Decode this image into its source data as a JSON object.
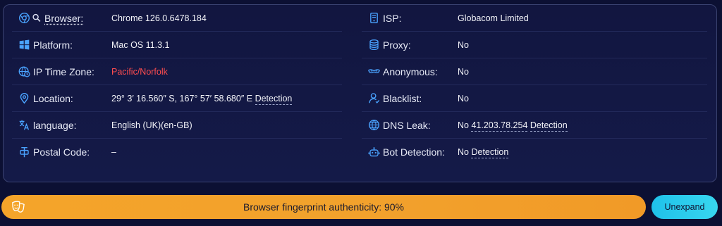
{
  "colors": {
    "accent": "#ff4d4f",
    "progress": "#f4a42a",
    "button": "#2ccbe9",
    "icon": "#4aa3ff"
  },
  "left": [
    {
      "icon": "chrome-icon",
      "icon2": "search-icon",
      "label": "Browser:",
      "value": "Chrome 126.0.6478.184"
    },
    {
      "icon": "windows-icon",
      "label": "Platform:",
      "value": "Mac OS 11.3.1"
    },
    {
      "icon": "globe-clock-icon",
      "label": "IP Time Zone:",
      "value": "Pacific/Norfolk"
    },
    {
      "icon": "location-pin-icon",
      "label": "Location:",
      "value": "29° 3′ 16.560″ S, 167° 57′ 58.680″ E",
      "link": "Detection"
    },
    {
      "icon": "translate-icon",
      "label": "language:",
      "value": "English (UK)(en-GB)"
    },
    {
      "icon": "postal-icon",
      "label": "Postal Code:",
      "value": "–"
    }
  ],
  "right": [
    {
      "icon": "server-icon",
      "label": "ISP:",
      "value": "Globacom Limited"
    },
    {
      "icon": "database-icon",
      "label": "Proxy:",
      "value": "No"
    },
    {
      "icon": "mask-icon",
      "label": "Anonymous:",
      "value": "No"
    },
    {
      "icon": "user-icon",
      "label": "Blacklist:",
      "value": "No"
    },
    {
      "icon": "globe-icon",
      "label": "DNS Leak:",
      "value": "No",
      "ip": "41.203.78.254",
      "link": "Detection"
    },
    {
      "icon": "robot-icon",
      "label": "Bot Detection:",
      "value": "No",
      "link": "Detection"
    }
  ],
  "footer": {
    "progress_text": "Browser fingerprint authenticity: 90%",
    "progress_value": 0.9,
    "icon": "theater-mask-icon",
    "button_label": "Unexpand"
  }
}
